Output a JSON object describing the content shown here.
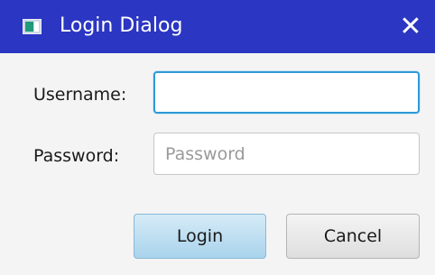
{
  "window": {
    "title": "Login Dialog",
    "close_glyph": "✕",
    "icon": "app-window-icon"
  },
  "form": {
    "username_label": "Username:",
    "username_value": "",
    "username_placeholder": "",
    "password_label": "Password:",
    "password_value": "",
    "password_placeholder": "Password"
  },
  "buttons": {
    "login_label": "Login",
    "cancel_label": "Cancel"
  },
  "colors": {
    "titlebar": "#2b36c2",
    "focus_ring": "#2d9ad6",
    "default_button": "#a9d3ec"
  }
}
